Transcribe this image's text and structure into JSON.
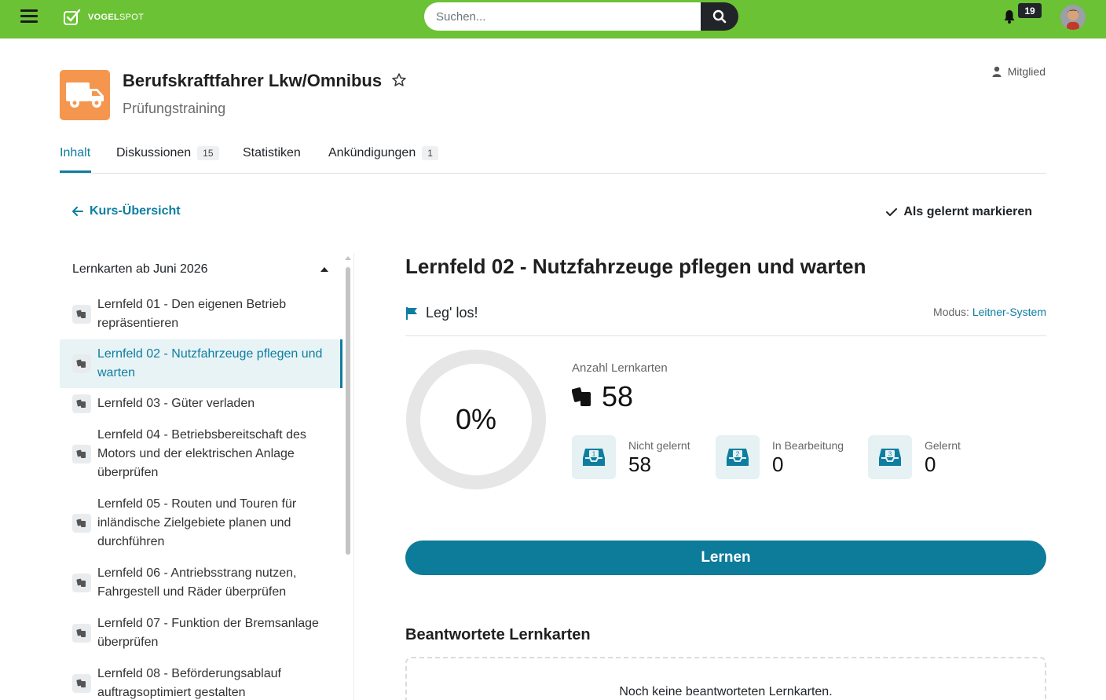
{
  "topbar": {
    "logo_brand": "VOGEL",
    "logo_suffix": "SPOT",
    "search_placeholder": "Suchen...",
    "notification_count": "19",
    "accent_color": "#6cc235"
  },
  "course": {
    "title": "Berufskraftfahrer Lkw/Omnibus",
    "subtitle": "Prüfungstraining",
    "role": "Mitglied",
    "icon": "truck-icon"
  },
  "tabs": [
    {
      "label": "Inhalt",
      "badge": ""
    },
    {
      "label": "Diskussionen",
      "badge": "15"
    },
    {
      "label": "Statistiken",
      "badge": ""
    },
    {
      "label": "Ankündigungen",
      "badge": "1"
    }
  ],
  "actions": {
    "back_label": "Kurs-Übersicht",
    "mark_learned_label": "Als gelernt markieren"
  },
  "sidebar": {
    "section_title": "Lernkarten ab Juni 2026",
    "items": [
      {
        "label": "Lernfeld 01 - Den eigenen Betrieb repräsentieren"
      },
      {
        "label": "Lernfeld 02 - Nutzfahrzeuge pflegen und warten"
      },
      {
        "label": "Lernfeld 03 - Güter verladen"
      },
      {
        "label": "Lernfeld 04 - Betriebsbereitschaft des Motors und der elektrischen Anlage überprüfen"
      },
      {
        "label": "Lernfeld 05 - Routen und Touren für inländische Zielgebiete planen und durchführen"
      },
      {
        "label": "Lernfeld 06 - Antriebsstrang nutzen, Fahrgestell und Räder überprüfen"
      },
      {
        "label": "Lernfeld 07 - Funktion der Bremsanlage überprüfen"
      },
      {
        "label": "Lernfeld 08 - Beförderungsablauf auftragsoptimiert gestalten"
      }
    ]
  },
  "main": {
    "title": "Lernfeld 02 - Nutzfahrzeuge pflegen und warten",
    "letsgo": "Leg' los!",
    "mode_prefix": "Modus:",
    "mode_value": "Leitner-System",
    "progress_label": "0%",
    "progress_fraction": 0,
    "count_label": "Anzahl Lernkarten",
    "count_value": "58",
    "boxes": [
      {
        "num": "1",
        "label": "Nicht gelernt",
        "value": "58"
      },
      {
        "num": "2",
        "label": "In Bearbeitung",
        "value": "0"
      },
      {
        "num": "3",
        "label": "Gelernt",
        "value": "0"
      }
    ],
    "learn_button": "Lernen",
    "answered_title": "Beantwortete Lernkarten",
    "answered_empty": "Noch keine beantworteten Lernkarten."
  }
}
